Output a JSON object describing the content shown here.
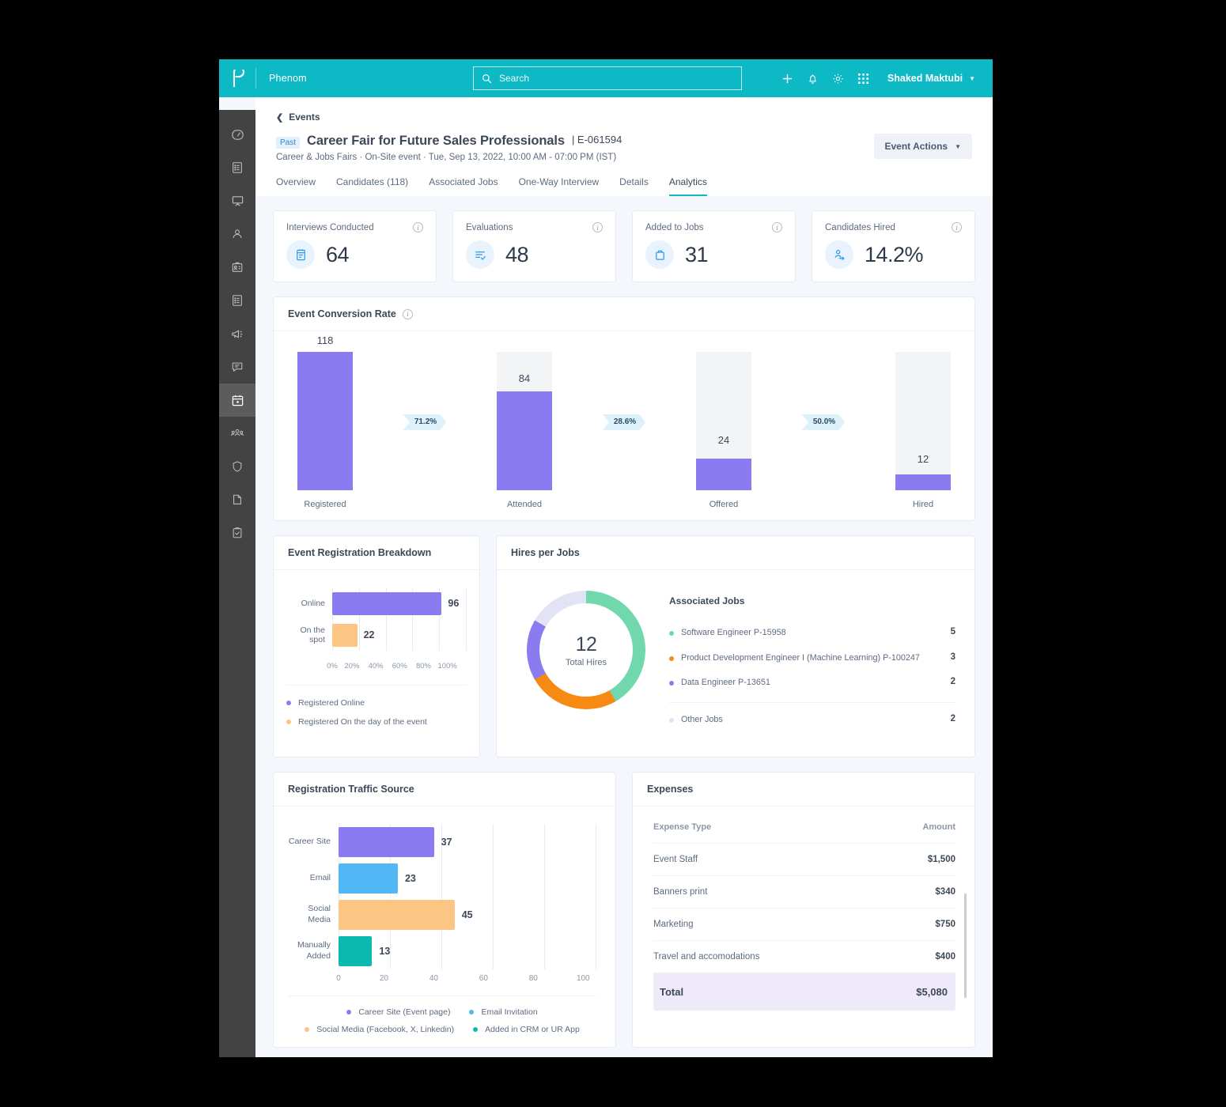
{
  "topbar": {
    "logo": "phenom-logo-icon",
    "brand": "Phenom",
    "search_placeholder": "Search",
    "user_name": "Shaked Maktubi",
    "icons": [
      "plus-icon",
      "bell-icon",
      "gear-icon",
      "apps-grid-icon"
    ]
  },
  "sidebar": {
    "items": [
      {
        "name": "dashboard",
        "icon": "speedometer-icon"
      },
      {
        "name": "lists",
        "icon": "list-card-icon"
      },
      {
        "name": "presentations",
        "icon": "presentation-icon"
      },
      {
        "name": "candidates",
        "icon": "person-icon"
      },
      {
        "name": "badges",
        "icon": "id-badge-icon"
      },
      {
        "name": "jobs",
        "icon": "list-card-icon"
      },
      {
        "name": "campaigns",
        "icon": "megaphone-icon"
      },
      {
        "name": "messages",
        "icon": "chat-icon"
      },
      {
        "name": "events",
        "icon": "calendar-icon",
        "active": true
      },
      {
        "name": "teams",
        "icon": "people-group-icon"
      },
      {
        "name": "security",
        "icon": "shield-icon"
      },
      {
        "name": "documents",
        "icon": "file-icon"
      },
      {
        "name": "tasks",
        "icon": "clipboard-check-icon"
      }
    ]
  },
  "page": {
    "breadcrumb": "Events",
    "status_badge": "Past",
    "title": "Career Fair for Future Sales Professionals",
    "event_id": "| E-061594",
    "subtitle": "Career & Jobs Fairs  ·  On-Site event  ·  Tue, Sep 13, 2022, 10:00 AM - 07:00 PM (IST)",
    "actions_button": "Event Actions",
    "tabs": [
      {
        "label": "Overview",
        "active": false
      },
      {
        "label": "Candidates (118)",
        "active": false
      },
      {
        "label": "Associated Jobs",
        "active": false
      },
      {
        "label": "One-Way Interview",
        "active": false
      },
      {
        "label": "Details",
        "active": false
      },
      {
        "label": "Analytics",
        "active": true
      }
    ]
  },
  "kpis": [
    {
      "label": "Interviews Conducted",
      "value": "64",
      "icon": "calendar-clipboard-icon"
    },
    {
      "label": "Evaluations",
      "value": "48",
      "icon": "list-check-icon"
    },
    {
      "label": "Added to Jobs",
      "value": "31",
      "icon": "briefcase-icon"
    },
    {
      "label": "Candidates Hired",
      "value": "14.2%",
      "icon": "person-arrow-icon"
    }
  ],
  "chart_data": [
    {
      "type": "bar",
      "title": "Event Conversion Rate",
      "categories": [
        "Registered",
        "Attended",
        "Offered",
        "Hired"
      ],
      "values": [
        118,
        84,
        24,
        12
      ],
      "value_labels": [
        "118",
        "84",
        "24",
        "12"
      ],
      "track_max": 118,
      "conversions": [
        "71.2%",
        "28.6%",
        "50.0%"
      ],
      "bar_color": "#8b7bf0",
      "track_color": "#f3f4f6",
      "chip_color": "#ddf1fb",
      "ylabel": "",
      "xlabel": "",
      "grid": false
    },
    {
      "type": "bar",
      "orientation": "horizontal",
      "title": "Event Registration Breakdown",
      "categories": [
        "Online",
        "On the spot"
      ],
      "values": [
        96,
        22
      ],
      "value_labels": [
        "96",
        "22"
      ],
      "percents": [
        81.4,
        18.6
      ],
      "xticks": [
        "0%",
        "20%",
        "40%",
        "60%",
        "80%",
        "100%"
      ],
      "xlim": [
        0,
        100
      ],
      "colors": [
        "#8b7bf0",
        "#fbc583"
      ],
      "legend": [
        {
          "label": "Registered Online",
          "color": "#8b7bf0"
        },
        {
          "label": "Registered On the day of the event",
          "color": "#fbc583"
        }
      ]
    },
    {
      "type": "pie",
      "title": "Hires per Jobs",
      "center_value": "12",
      "center_caption": "Total Hires",
      "total": 12,
      "slices": [
        {
          "label": "Software Engineer P-15958",
          "value": 5,
          "color": "#71d8ad"
        },
        {
          "label": "Product Development Engineer I (Machine Learning) P-100247",
          "value": 3,
          "color": "#f78a12"
        },
        {
          "label": "Data Engineer P-13651",
          "value": 2,
          "color": "#8b7bf0"
        },
        {
          "label": "Other Jobs",
          "value": 2,
          "color": "#e2e4f6"
        }
      ],
      "legend_title": "Associated Jobs",
      "legend_position": "right"
    },
    {
      "type": "bar",
      "orientation": "horizontal",
      "title": "Registration Traffic Source",
      "categories": [
        "Career Site",
        "Email",
        "Social Media",
        "Manually Added"
      ],
      "values": [
        37,
        23,
        45,
        13
      ],
      "value_labels": [
        "37",
        "23",
        "45",
        "13"
      ],
      "xticks": [
        "0",
        "20",
        "40",
        "60",
        "80",
        "100"
      ],
      "xlim": [
        0,
        100
      ],
      "colors": [
        "#8b7bf0",
        "#52b8f5",
        "#fbc583",
        "#0cb9b0"
      ],
      "legend": [
        {
          "label": "Career Site (Event page)",
          "color": "#8b7bf0"
        },
        {
          "label": "Email Invitation",
          "color": "#52b8f5"
        },
        {
          "label": "Social Media (Facebook, X, Linkedin)",
          "color": "#fbc583"
        },
        {
          "label": "Added in CRM or UR App",
          "color": "#0cb9b0"
        }
      ]
    },
    {
      "type": "table",
      "title": "Expenses",
      "columns": [
        "Expense Type",
        "Amount"
      ],
      "rows": [
        [
          "Event Staff",
          "$1,500"
        ],
        [
          "Banners print",
          "$340"
        ],
        [
          "Marketing",
          "$750"
        ],
        [
          "Travel and accomodations",
          "$400"
        ]
      ],
      "total_label": "Total",
      "total_value": "$5,080"
    }
  ],
  "colors": {
    "brand_teal": "#0cb9c4",
    "purple": "#8b7bf0",
    "orange": "#fbc583",
    "blue": "#52b8f5",
    "teal": "#0cb9b0",
    "green": "#71d8ad",
    "deep_orange": "#f78a12",
    "lavender": "#e2e4f6",
    "text_dark": "#3c4858",
    "text_muted": "#5c6b80",
    "page_bg": "#f4f7fc"
  }
}
